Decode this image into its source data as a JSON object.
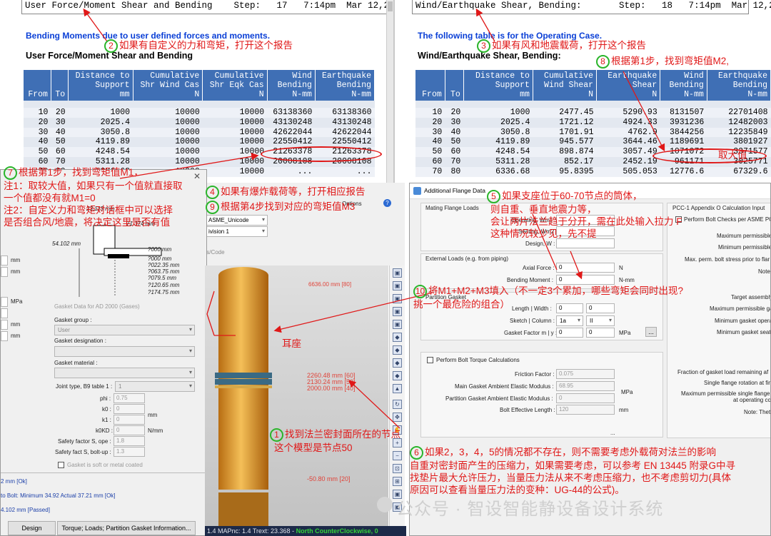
{
  "left_report": {
    "header_bar": "User Force/Moment Shear and Bending    Step:   17   7:14pm  Mar 12,2025",
    "blue_title": "Bending Moments due to user defined forces and moments.",
    "black_title": "User Force/Moment Shear and Bending",
    "columns": [
      "From",
      "To",
      "Distance to\nSupport\nmm",
      "Cumulative\nShr Wind Cas\nN",
      "Cumulative\nShr Eqk Cas\nN",
      "Wind\nBending\nN-mm",
      "Earthquake\nBending\nN-mm"
    ],
    "rows": [
      [
        "10",
        "20",
        "1000",
        "10000",
        "10000",
        "63138360",
        "63138360"
      ],
      [
        "20",
        "30",
        "2025.4",
        "10000",
        "10000",
        "43130248",
        "43130248"
      ],
      [
        "30",
        "40",
        "3050.8",
        "10000",
        "10000",
        "42622044",
        "42622044"
      ],
      [
        "40",
        "50",
        "4119.89",
        "10000",
        "10000",
        "22550412",
        "22550412"
      ],
      [
        "50",
        "60",
        "4248.54",
        "10000",
        "10000",
        "21263378",
        "21263378"
      ],
      [
        "60",
        "70",
        "5311.28",
        "10000",
        "10000",
        "20008108",
        "20008108"
      ],
      [
        "70",
        "80",
        "6336.68",
        "10000",
        "10000",
        "...",
        "..."
      ]
    ]
  },
  "right_report": {
    "header_bar": "Wind/Earthquake Shear, Bending:       Step:   18   7:14pm  Mar 12,2025",
    "blue_title": "The following table is for the Operating Case.",
    "black_title": "Wind/Earthquake Shear, Bending:",
    "columns": [
      "From",
      "To",
      "Distance to\nSupport\nmm",
      "Cumulative\nWind Shear\nN",
      "Earthquake\nShear\nN",
      "Wind\nBending\nN-mm",
      "Earthquake\nBending\nN-mm"
    ],
    "rows": [
      [
        "10",
        "20",
        "1000",
        "2477.45",
        "5290.93",
        "8131507",
        "22701408"
      ],
      [
        "20",
        "30",
        "2025.4",
        "1721.12",
        "4924.33",
        "3931236",
        "12482003"
      ],
      [
        "30",
        "40",
        "3050.8",
        "1701.91",
        "4762.9",
        "3844256",
        "12235849"
      ],
      [
        "40",
        "50",
        "4119.89",
        "945.577",
        "3644.46",
        "1189691",
        "3801927"
      ],
      [
        "50",
        "60",
        "4248.54",
        "898.874",
        "3057.49",
        "1071072",
        "3371577"
      ],
      [
        "60",
        "70",
        "5311.28",
        "852.17",
        "2452.19",
        "961171",
        "3025771"
      ],
      [
        "70",
        "80",
        "6336.68",
        "95.8395",
        "505.053",
        "12776.6",
        "67329.6"
      ]
    ]
  },
  "left_dialog": {
    "flange_dims": [
      "23.113 mm",
      "71.374 mm",
      "54.102 mm",
      "?000 mm",
      "?000 mm",
      "?022.35 mm",
      "?063.75 mm",
      "?079.5 mm",
      "?120.65 mm",
      "?174.75 mm"
    ],
    "unit_mm": "mm",
    "unit_mpa": "MPa",
    "gasket_section": "Gasket Data for AD 2000 (Gases)",
    "gasket_group_label": "Gasket group :",
    "gasket_group_value": "User",
    "gasket_designation_label": "Gasket designation :",
    "gasket_material_label": "Gasket material :",
    "joint_type_label": "Joint type, B9 table 1 :",
    "joint_type_value": "1",
    "phi_label": "phi :",
    "phi_value": "0.75",
    "k0_label": "k0 :",
    "k0_value": "0",
    "k1_label": "k1 :",
    "k1_value": "0",
    "k0kd_label": "k0KD :",
    "k0kd_value": "0",
    "unit_nmm": "N/mm",
    "sf_ope_label": "Safety factor S, ope :",
    "sf_ope_value": "1.8",
    "sf_bolt_label": "Safety fact S, bolt-up :",
    "sf_bolt_value": "1.3",
    "soft_label": "Gasket is soft or metal coated",
    "status_1": "2 mm  [Ok]",
    "status_2": "to Bolt: Minimum 34.92   Actual 37.21 mm   [Ok]",
    "status_3": "4.102 mm     [Passed]",
    "btn_design": "Design",
    "btn_torque": "Torque; Loads; Partition Gasket Information..."
  },
  "middle_header": {
    "options": "Options",
    "font_combo": "ASME_Unicode",
    "division_combo": "ivision 1",
    "code_label": "ts/Code"
  },
  "view3d": {
    "dim_top": "6636.00 mm [80]",
    "dim_1": "2260.48 mm  [60]",
    "dim_2": "2130.24 mm  [50]",
    "dim_3": "2000.00 mm  [40]",
    "dim_bottom": "-50.80 mm  [20]",
    "status_text": "1.4   MAPnc: 1.4   Trext: 23.368  -",
    "status_green": "North CounterClockwise, 0"
  },
  "right_dialog": {
    "title": "Additional Flange Data",
    "mating_group": "Mating Flange Loads",
    "operating_label": "Operating, Wm1 :",
    "seating_label": "Seating, Wm2 :",
    "design_label": "Design, W :",
    "external_group": "External Loads (e.g. from piping)",
    "axial_label": "Axial Force :",
    "axial_value": "0",
    "axial_unit": "N",
    "bending_label": "Bending Moment :",
    "bending_value": "0",
    "bending_unit": "N-mm",
    "partition_group": "Partition Gasket",
    "length_label": "Length | Width :",
    "length_v1": "0",
    "length_v2": "0",
    "sketch_label": "Sketch | Column :",
    "sketch_v1": "1a",
    "sketch_v2": "II",
    "factor_label": "Gasket Factor m | y :",
    "factor_v1": "0",
    "factor_v2": "0",
    "factor_unit": "MPa",
    "factor_btn": "...",
    "torque_check": "Perform Bolt Torque Calculations",
    "friction_label": "Friction Factor :",
    "friction_value": "0.075",
    "main_mod_label": "Main Gasket Ambient Elastic Modulus :",
    "main_mod_value": "68.95",
    "main_mod_unit": "MPa",
    "part_mod_label": "Partition Gasket Ambient Elastic Modulus :",
    "part_mod_value": "0",
    "bolt_len_label": "Bolt Effective Length :",
    "bolt_len_value": "120",
    "bolt_len_unit": "mm",
    "bottom_btn": "...",
    "pcc_group": "PCC-1 Appendix O Calculation Input",
    "pcc_check": "Perform Bolt Checks per ASME PCC",
    "pcc_l1": "Maximum permissible",
    "pcc_l2": "Minimum permissible",
    "pcc_l3": "Max. perm. bolt stress prior to flar",
    "pcc_l4": "Note",
    "pcc_l5": "Target assembly",
    "pcc_l6": "Maximum permissible ga",
    "pcc_l7": "Minimum gasket operati",
    "pcc_l8": "Minimum gasket seat",
    "pcc_l9": "Fraction of gasket load remaining af",
    "pcc_l10": "Single flange rotation at fina",
    "pcc_l11": "Maximum permissible single flange",
    "pcc_l12": "at operating con",
    "pcc_l13": "Note: Thet"
  },
  "annotations": {
    "a2": "如果有自定义的力和弯矩，打开这个报告",
    "a3": "如果有风和地震载荷，打开这个报告",
    "a8": "根据第1步，找到弯矩值M2,",
    "a7_l1": "根据第1步，找到弯矩值M1，",
    "a7_l2": "注1：取较大值，如果只有一个值就直接取",
    "a7_l3": "一个值都没有就M1=0",
    "a7_l4": "注2：自定义力和弯矩对话框中可以选择",
    "a7_l5": "是否组合风/地震，将决定这里是否有值",
    "a4": "如果有爆炸载荷等，打开相应报告",
    "a9": "根据第4步找到对应的弯矩值M3",
    "a5_l1": "如果支座位于60-70节点的筒体，",
    "a5_l2": "则自重、垂直地震力等，",
    "a5_l3": "会让两片法兰趋于分开，需在此处输入拉力 F",
    "a5_l4": "这种情况较少见，先不提",
    "max_label": "取大值",
    "a10_l1": "将M1+M2+M3填入（不一定3个累加，哪些弯矩会同时出现?",
    "a10_l2": "挑一个最危险的组合）",
    "skirt": "耳座",
    "a1_l1": "找到法兰密封面所在的节点",
    "a1_l2": "这个模型是节点50",
    "a6_l1": "如果2，3，4，5的情况都不存在，则不需要考虑外载荷对法兰的影响",
    "a6_l2": "自重对密封面产生的压缩力，如果需要考虑，可以参考 EN 13445 附录G中寻",
    "a6_l3": "找垫片最大允许压力，当量压力法从来不考虑压缩力，也不考虑剪切力(具体",
    "a6_l4": "原因可以查看当量压力法的变种：UG-44的公式)。",
    "watermark": "公众号 · 智设智能静设备设计系统",
    "n1": "1",
    "n2": "2",
    "n3": "3",
    "n4": "4",
    "n5": "5",
    "n6": "6",
    "n7": "7",
    "n8": "8",
    "n9": "9",
    "n10": "10"
  },
  "colors": {
    "table_header": "#3f6fb5",
    "annotation": "#e01818",
    "step_circle": "#2bb52b",
    "vessel": "#e8a23a"
  }
}
